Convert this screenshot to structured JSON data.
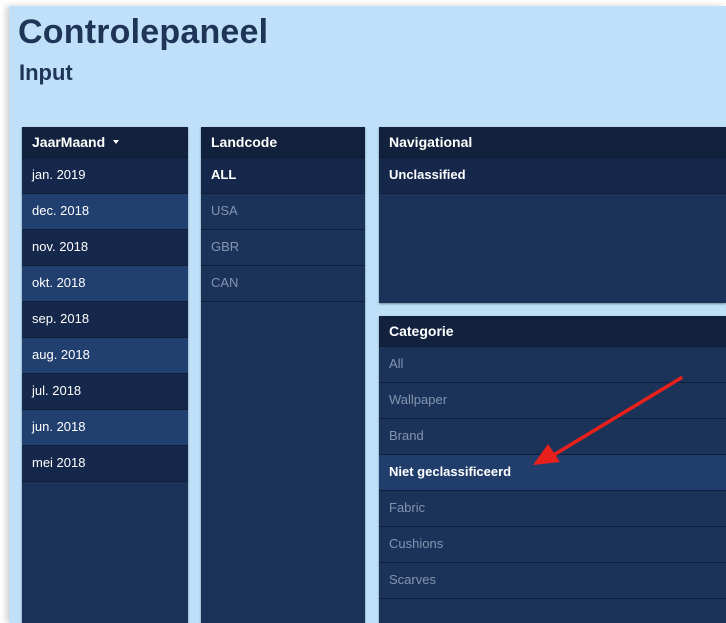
{
  "header": {
    "title": "Controlepaneel",
    "subtitle": "Input"
  },
  "jaarmaand": {
    "header": "JaarMaand",
    "items": [
      "jan. 2019",
      "dec. 2018",
      "nov. 2018",
      "okt. 2018",
      "sep. 2018",
      "aug. 2018",
      "jul. 2018",
      "jun. 2018",
      "mei 2018"
    ]
  },
  "landcode": {
    "header": "Landcode",
    "items": [
      "ALL",
      "USA",
      "GBR",
      "CAN"
    ]
  },
  "navigational": {
    "header": "Navigational",
    "items": [
      "Unclassified"
    ]
  },
  "categorie": {
    "header": "Categorie",
    "items": [
      "All",
      "Wallpaper",
      "Brand",
      "Niet geclassificeerd",
      "Fabric",
      "Cushions",
      "Scarves"
    ]
  },
  "colors": {
    "background": "#bfe0f8",
    "panel": "#1c3359",
    "panel_header": "#12213e",
    "title_text": "#1f3558",
    "annotation_arrow": "#e8201c"
  },
  "icons": {
    "sort_dropdown": "caret-down-icon",
    "annotation": "red-arrow-icon"
  }
}
